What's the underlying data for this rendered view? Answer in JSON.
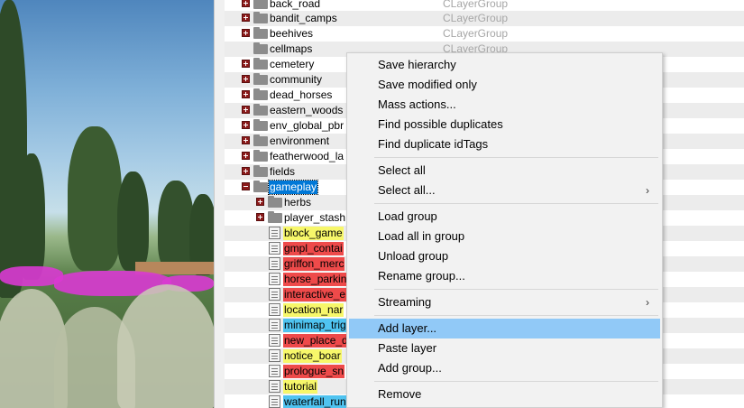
{
  "tree": {
    "rows": [
      {
        "label": "back_road",
        "type": "CLayerGroup"
      },
      {
        "label": "bandit_camps",
        "type": "CLayerGroup"
      },
      {
        "label": "beehives",
        "type": "CLayerGroup"
      },
      {
        "label": "cellmaps",
        "type": "CLayerGroup"
      },
      {
        "label": "cemetery"
      },
      {
        "label": "community"
      },
      {
        "label": "dead_horses"
      },
      {
        "label": "eastern_woods"
      },
      {
        "label": "env_global_pbr"
      },
      {
        "label": "environment"
      },
      {
        "label": "featherwood_la"
      },
      {
        "label": "fields"
      },
      {
        "label": "gameplay"
      },
      {
        "label": "herbs"
      },
      {
        "label": "player_stash"
      },
      {
        "label": "block_game"
      },
      {
        "label": "gmpl_contai"
      },
      {
        "label": "griffon_merc"
      },
      {
        "label": "horse_parkin"
      },
      {
        "label": "interactive_e"
      },
      {
        "label": "location_nar"
      },
      {
        "label": "minimap_trig"
      },
      {
        "label": "new_place_d"
      },
      {
        "label": "notice_boar"
      },
      {
        "label": "prologue_sn"
      },
      {
        "label": "tutorial"
      },
      {
        "label": "waterfall_run"
      }
    ]
  },
  "colors": {
    "yellow": "#f7f76a",
    "red": "#ee4a4a",
    "blue": "#4fc3f0",
    "selection": "#0078d7",
    "menu_hover": "#91c9f7",
    "expander": "#8b1a1a"
  },
  "menu": {
    "items": [
      {
        "label": "Save hierarchy"
      },
      {
        "label": "Save modified only"
      },
      {
        "label": "Mass actions..."
      },
      {
        "label": "Find possible duplicates"
      },
      {
        "label": "Find duplicate idTags"
      },
      {
        "label": "Select all"
      },
      {
        "label": "Select all...",
        "submenu": "›"
      },
      {
        "label": "Load group"
      },
      {
        "label": "Load all in group"
      },
      {
        "label": "Unload group"
      },
      {
        "label": "Rename group..."
      },
      {
        "label": "Streaming",
        "submenu": "›"
      },
      {
        "label": "Add layer..."
      },
      {
        "label": "Paste layer"
      },
      {
        "label": "Add group..."
      },
      {
        "label": "Remove"
      }
    ]
  }
}
